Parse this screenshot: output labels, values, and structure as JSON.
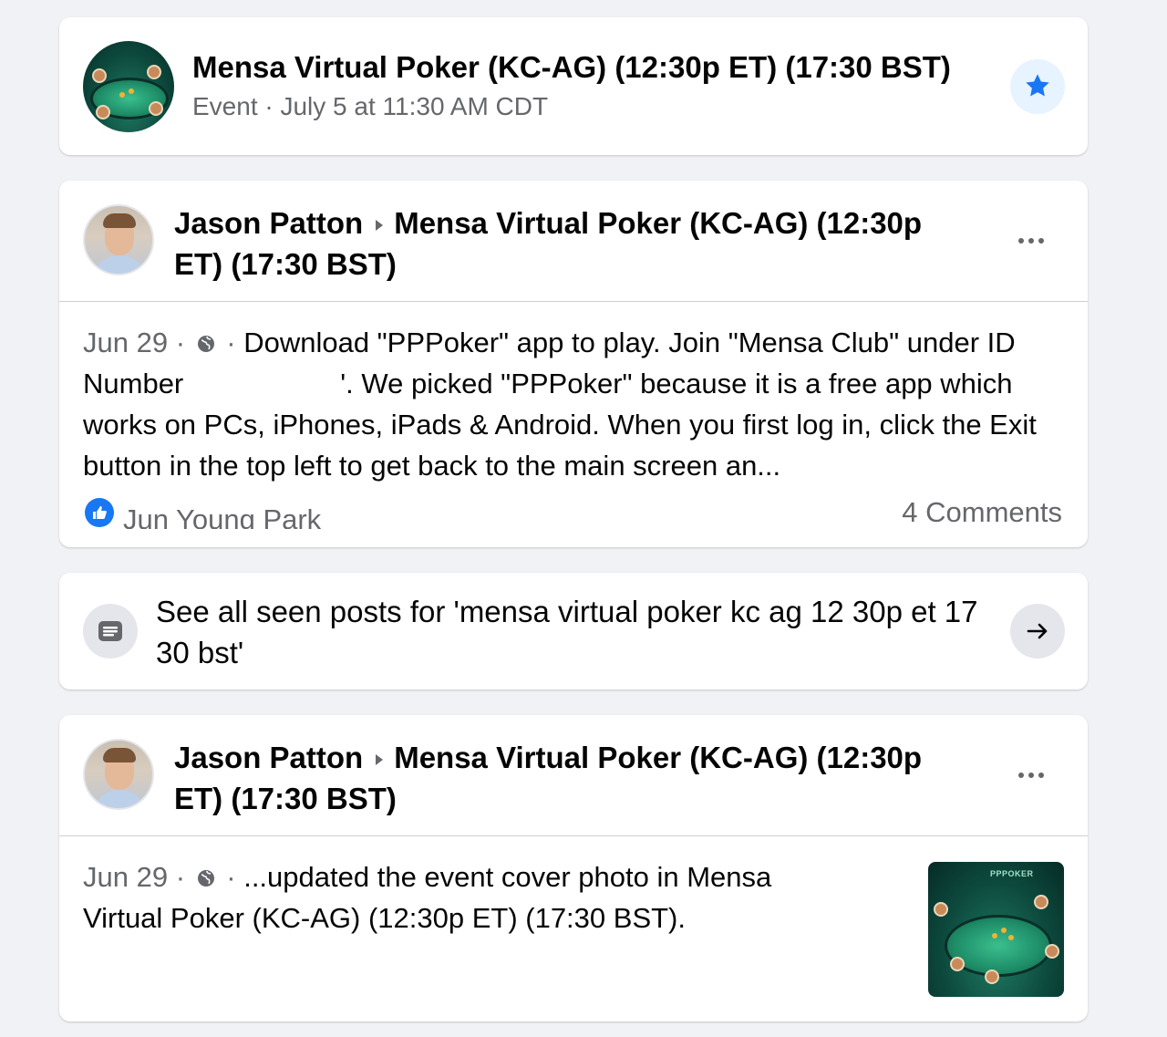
{
  "event": {
    "title": "Mensa Virtual Poker (KC-AG) (12:30p ET) (17:30 BST)",
    "subtitle": "Event · July 5 at 11:30 AM CDT",
    "star_icon": "star-icon",
    "accent_color": "#1877f2"
  },
  "posts": [
    {
      "author": "Jason Patton",
      "target": "Mensa Virtual Poker (KC-AG) (12:30p ET) (17:30 BST)",
      "date": "Jun 29",
      "sep1": " · ",
      "sep2": " · ",
      "text_a": "Download \"PPPoker\" app to play. Join \"Mensa Club\" under ID Number",
      "text_b": "'. We picked \"PPPoker\" because it is a free app which works on PCs, iPhones, iPads & Android. When you first log in, click the Exit button in the top left to get back to the main screen an...",
      "reactor": "Jun Young Park",
      "comments": "4 Comments"
    },
    {
      "author": "Jason Patton",
      "target": "Mensa Virtual Poker (KC-AG) (12:30p ET) (17:30 BST)",
      "date": "Jun 29",
      "sep1": " · ",
      "sep2": " · ",
      "text": "...updated the event cover photo in Mensa Virtual Poker (KC-AG) (12:30p ET) (17:30 BST).",
      "thumb_logo": "PPPOKER"
    }
  ],
  "see_all": {
    "text": "See all seen posts for 'mensa virtual poker kc ag 12 30p et 17 30 bst'"
  }
}
